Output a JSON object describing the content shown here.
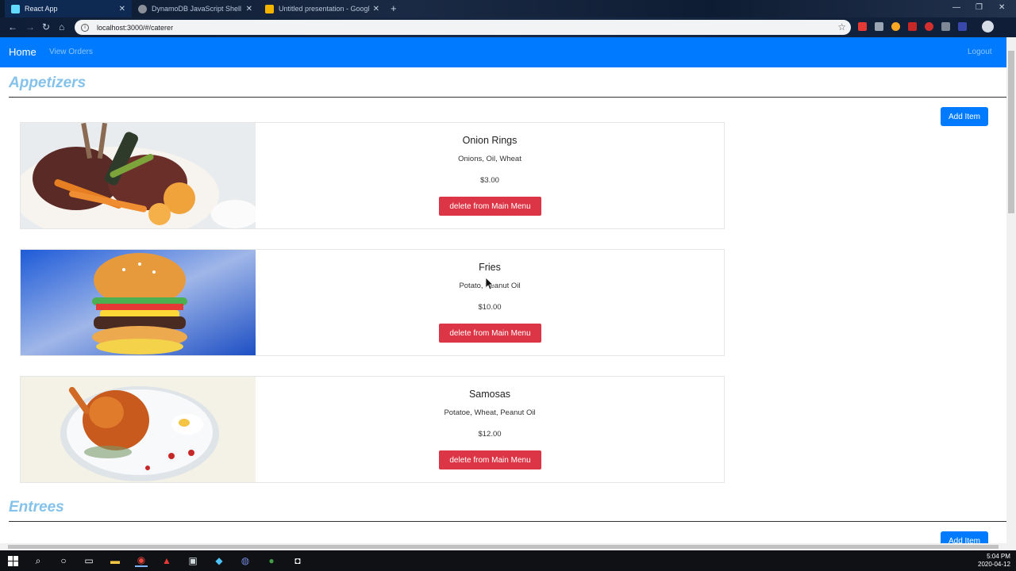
{
  "browser": {
    "tabs": [
      {
        "title": "React App",
        "active": true
      },
      {
        "title": "DynamoDB JavaScript Shell",
        "active": false
      },
      {
        "title": "Untitled presentation - Google S",
        "active": false
      }
    ],
    "url": "localhost:3000/#/caterer"
  },
  "navbar": {
    "brand": "Home",
    "links": [
      "View Orders"
    ],
    "logout": "Logout",
    "color": "#007bff"
  },
  "sections": [
    {
      "title": "Appetizers",
      "add_label": "Add Item",
      "items": [
        {
          "name": "Onion Rings",
          "ingredients": "Onions, Oil, Wheat",
          "price": "$3.00",
          "action": "delete from Main Menu"
        },
        {
          "name": "Fries",
          "ingredients": "Potato, Peanut Oil",
          "price": "$10.00",
          "action": "delete from Main Menu"
        },
        {
          "name": "Samosas",
          "ingredients": "Potatoe, Wheat, Peanut Oil",
          "price": "$12.00",
          "action": "delete from Main Menu"
        }
      ]
    },
    {
      "title": "Entrees",
      "add_label": "Add Item",
      "items": []
    }
  ],
  "taskbar": {
    "time": "5:04 PM",
    "date": "2020-04-12"
  },
  "colors": {
    "section_title": "#84c2ec",
    "delete_button": "#dc3545",
    "add_button": "#007bff"
  }
}
